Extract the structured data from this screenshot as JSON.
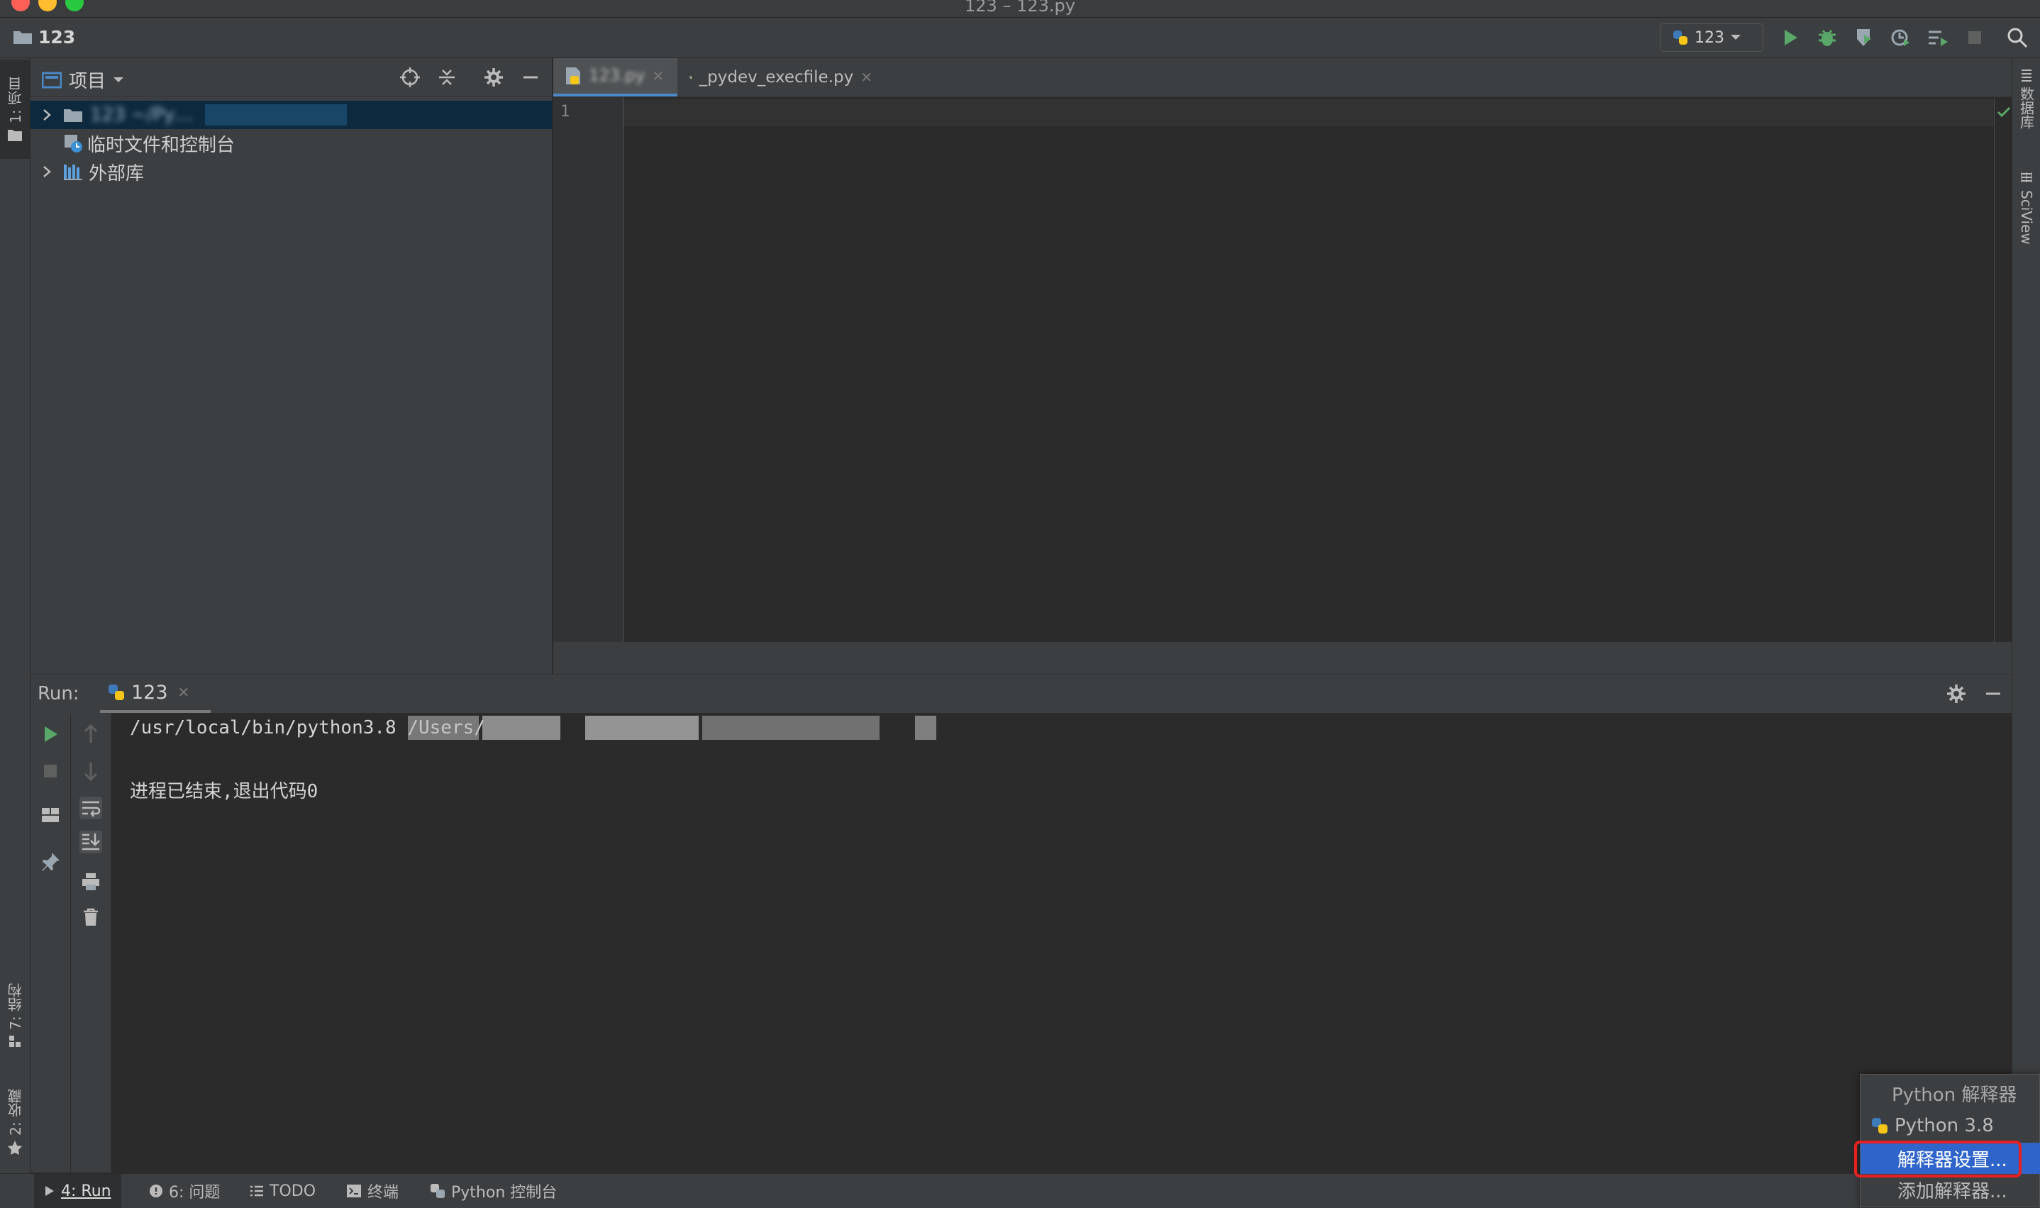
{
  "window": {
    "title": "123 – 123.py"
  },
  "navbar": {
    "breadcrumb": "123",
    "run_config": "123"
  },
  "left_stripe": {
    "project": "1: 项目",
    "structure": "7: 结构",
    "favorites": "2: 收藏"
  },
  "right_stripe": {
    "database": "数据库",
    "sciview": "SciView"
  },
  "project_panel": {
    "title": "项目",
    "tree": [
      {
        "label": "123  ~/Py…",
        "expanded": false
      },
      {
        "label": "临时文件和控制台"
      },
      {
        "label": "外部库",
        "expanded": false
      }
    ]
  },
  "editor": {
    "tabs": [
      {
        "label": "123.py",
        "active": true
      },
      {
        "label": "_pydev_execfile.py",
        "active": false
      }
    ],
    "line_numbers": [
      "1"
    ]
  },
  "run_panel": {
    "label": "Run:",
    "tab": "123",
    "console_lines": [
      "/usr/local/bin/python3.8 /Users/",
      "进程已结束,退出代码0"
    ]
  },
  "statusbar": {
    "tabs": [
      {
        "num": "4",
        "label": "4: Run"
      },
      {
        "num": "6",
        "label": "6: 问题"
      },
      {
        "label": "TODO"
      },
      {
        "label": "终端"
      },
      {
        "label": "Python 控制台"
      }
    ]
  },
  "interpreter_popup": {
    "header": "Python 解释器",
    "current": "Python 3.8",
    "settings": "解释器设置...",
    "add": "添加解释器..."
  },
  "colors": {
    "accent": "#2f65ca",
    "run_green": "#59a869",
    "highlight": "#e82020"
  }
}
